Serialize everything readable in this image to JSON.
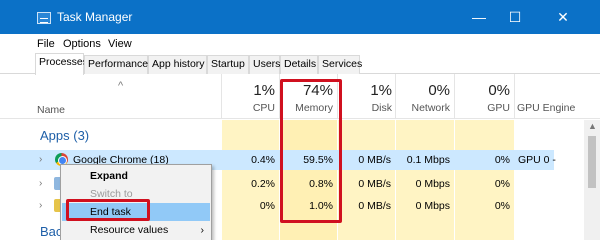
{
  "window": {
    "title": "Task Manager",
    "controls": {
      "minimize": "—",
      "maximize": "☐",
      "close": "✕"
    }
  },
  "menu": [
    "File",
    "Options",
    "View"
  ],
  "tabs": [
    "Processes",
    "Performance",
    "App history",
    "Startup",
    "Users",
    "Details",
    "Services"
  ],
  "columns": {
    "name": "Name",
    "cpu": {
      "pct": "1%",
      "label": "CPU"
    },
    "memory": {
      "pct": "74%",
      "label": "Memory"
    },
    "disk": {
      "pct": "1%",
      "label": "Disk"
    },
    "network": {
      "pct": "0%",
      "label": "Network"
    },
    "gpu": {
      "pct": "0%",
      "label": "GPU"
    },
    "gpu_engine": "GPU Engine"
  },
  "section_apps": "Apps (3)",
  "section_background": "Back",
  "rows": [
    {
      "name": "Google Chrome (18)",
      "cpu": "0.4%",
      "memory": "59.5%",
      "disk": "0 MB/s",
      "network": "0.1 Mbps",
      "gpu": "0%",
      "gpu_engine": "GPU 0 -"
    },
    {
      "cpu": "0.2%",
      "memory": "0.8%",
      "disk": "0 MB/s",
      "network": "0 Mbps",
      "gpu": "0%"
    },
    {
      "cpu": "0%",
      "memory": "1.0%",
      "disk": "0 MB/s",
      "network": "0 Mbps",
      "gpu": "0%"
    }
  ],
  "context_menu": {
    "expand": "Expand",
    "switch_to": "Switch to",
    "end_task": "End task",
    "resource_values": "Resource values",
    "submenu_arrow": "›"
  },
  "colors": {
    "titlebar": "#0b71c7",
    "highlight": "#cce8ff",
    "heat_cell": "#fff4c4",
    "annotation": "#d0101f"
  }
}
